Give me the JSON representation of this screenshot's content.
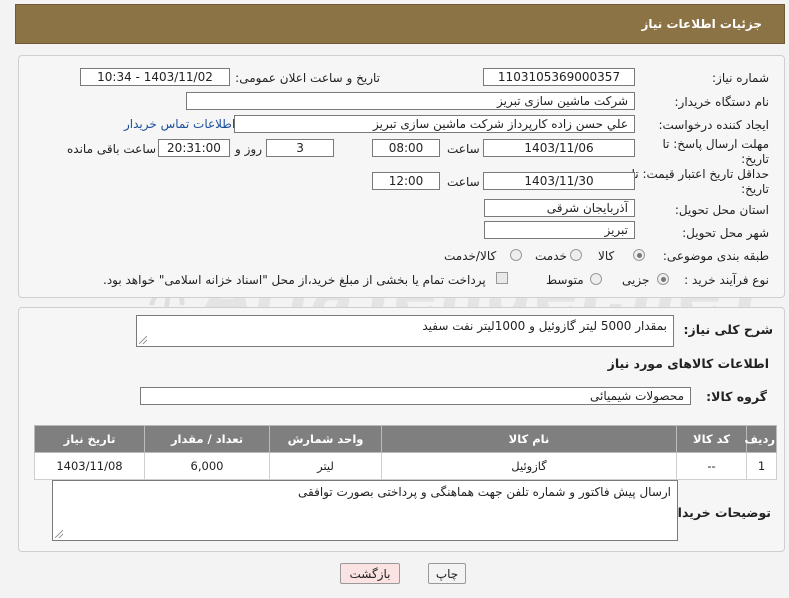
{
  "title": "جزئیات اطلاعات نیاز",
  "fields": {
    "need_number_label": "شماره نیاز:",
    "need_number": "1103105369000357",
    "announce_label": "تاریخ و ساعت اعلان عمومی:",
    "announce_value": "1403/11/02 - 10:34",
    "buyer_org_label": "نام دستگاه خریدار:",
    "buyer_org": "شرکت ماشین سازی تبریز",
    "creator_label": "ایجاد کننده درخواست:",
    "creator": "علي حسن زاده کارپرداز شرکت ماشین سازی تبریز",
    "contact_link": "اطلاعات تماس خریدار",
    "reply_deadline_label": "مهلت ارسال پاسخ: تا تاریخ:",
    "reply_date": "1403/11/06",
    "time_label": "ساعت",
    "reply_time": "08:00",
    "days": "3",
    "days_label": "روز و",
    "remaining_time": "20:31:00",
    "remaining_label": "ساعت باقی مانده",
    "price_validity_label": "حداقل تاریخ اعتبار قیمت: تا تاریخ:",
    "price_date": "1403/11/30",
    "price_time": "12:00",
    "province_label": "استان محل تحویل:",
    "province": "آذربایجان شرقی",
    "city_label": "شهر محل تحویل:",
    "city": "تبریز",
    "category_label": "طبقه بندی موضوعی:",
    "category_options": [
      "کالا",
      "خدمت",
      "کالا/خدمت"
    ],
    "process_label": "نوع فرآیند خرید :",
    "process_options": [
      "جزیی",
      "متوسط"
    ],
    "payment_note": "پرداخت تمام یا بخشی از مبلغ خرید،از محل \"اسناد خزانه اسلامی\" خواهد بود."
  },
  "general": {
    "desc_label": "شرح کلی نیاز:",
    "desc": "بمقدار 5000 لیتر گازوئیل و 1000لیتر نفت سفید",
    "items_title": "اطلاعات کالاهای مورد نیاز",
    "group_label": "گروه کالا:",
    "group": "محصولات شیمیائی"
  },
  "table": {
    "headers": [
      "ردیف",
      "کد کالا",
      "نام کالا",
      "واحد شمارش",
      "تعداد / مقدار",
      "تاریخ نیاز"
    ],
    "rows": [
      [
        "1",
        "--",
        "گازوئیل",
        "لیتر",
        "6,000",
        "1403/11/08"
      ]
    ]
  },
  "buyer_notes": {
    "label": "توضیحات خریدار:",
    "text": "ارسال پیش فاکتور و شماره تلفن جهت هماهنگی و پرداختی بصورت توافقی"
  },
  "buttons": {
    "print": "چاپ",
    "back": "بازگشت"
  },
  "watermark": "AriaTender.neT",
  "colors": {
    "title_bg": "#8c7345",
    "table_header_bg": "#7f7f7f",
    "link": "#1a4f9b",
    "back_button_bg": "#fbe3e3"
  }
}
